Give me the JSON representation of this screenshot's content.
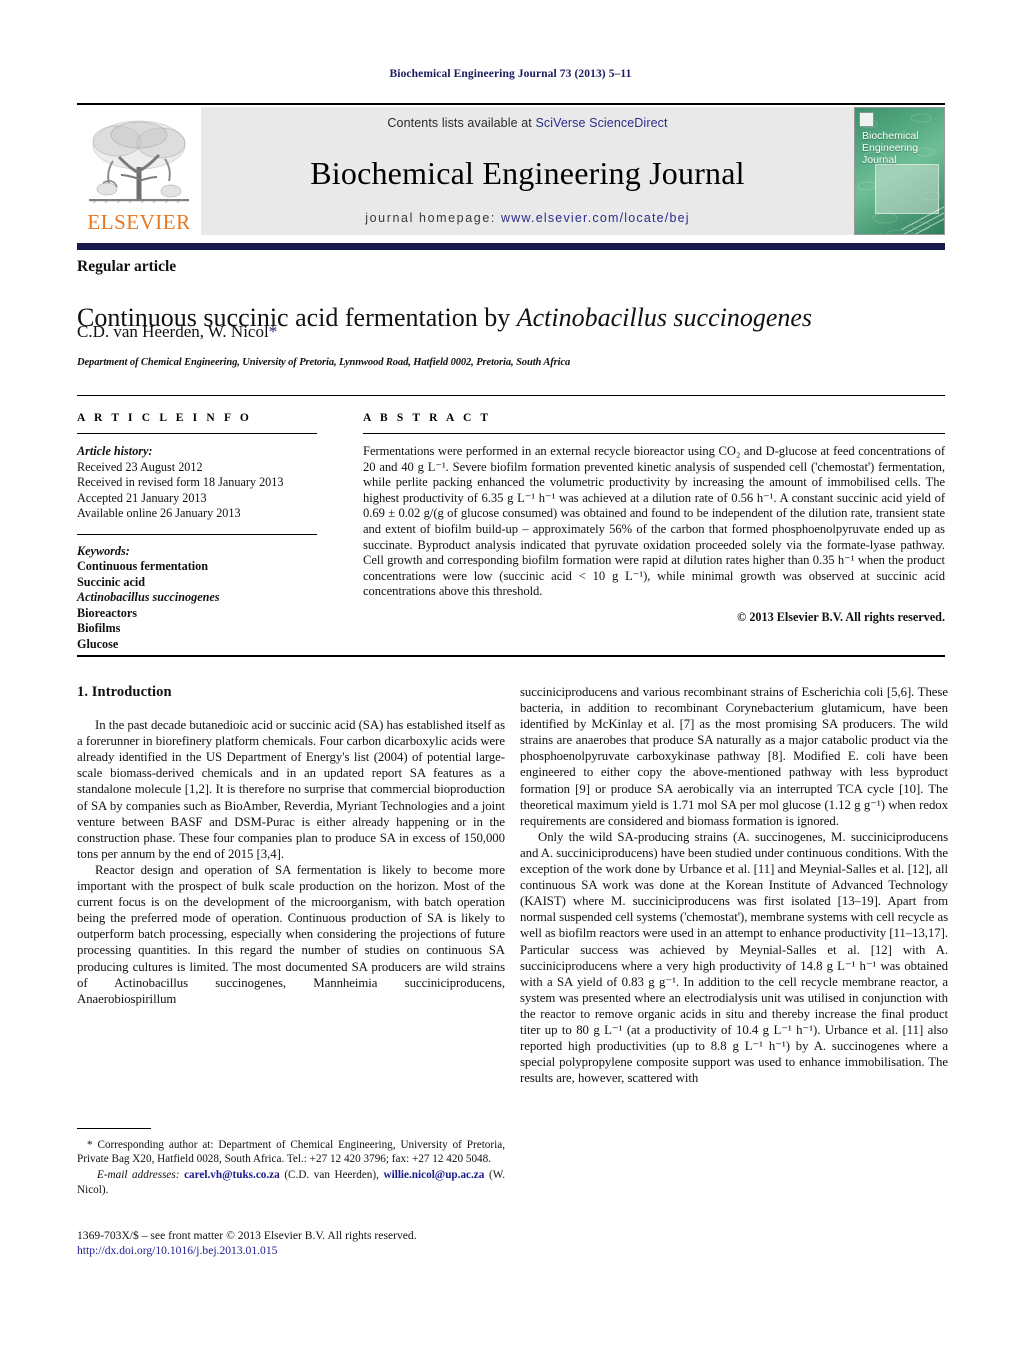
{
  "running_head": "Biochemical Engineering Journal 73 (2013) 5–11",
  "masthead": {
    "elsevier_wordmark": "ELSEVIER",
    "contents_prefix": "Contents lists available at ",
    "contents_link": "SciVerse ScienceDirect",
    "journal_title": "Biochemical Engineering Journal",
    "homepage_prefix": "journal homepage: ",
    "homepage_url": "www.elsevier.com/locate/bej",
    "cover_title": "Biochemical Engineering Journal",
    "brand_color": "#E87722",
    "link_color": "#2c2c8c",
    "band_color": "#19194d"
  },
  "title_block": {
    "article_type": "Regular article",
    "title_plain": "Continuous succinic acid fermentation by ",
    "title_italic": "Actinobacillus succinogenes",
    "authors": "C.D. van Heerden, W. Nicol",
    "author_star": "*",
    "affiliation": "Department of Chemical Engineering, University of Pretoria, Lynnwood Road, Hatfield 0002, Pretoria, South Africa"
  },
  "article_info": {
    "heading": "A R T I C L E   I N F O",
    "history_label": "Article history:",
    "history": [
      "Received 23 August 2012",
      "Received in revised form 18 January 2013",
      "Accepted 21 January 2013",
      "Available online 26 January 2013"
    ],
    "keywords_label": "Keywords:",
    "keywords": [
      "Continuous fermentation",
      "Succinic acid",
      "Actinobacillus succinogenes",
      "Bioreactors",
      "Biofilms",
      "Glucose"
    ],
    "keyword_italic_index": 2
  },
  "abstract": {
    "heading": "A B S T R A C T",
    "body": "Fermentations were performed in an external recycle bioreactor using CO₂ and D-glucose at feed concentrations of 20 and 40 g L⁻¹. Severe biofilm formation prevented kinetic analysis of suspended cell ('chemostat') fermentation, while perlite packing enhanced the volumetric productivity by increasing the amount of immobilised cells. The highest productivity of 6.35 g L⁻¹ h⁻¹ was achieved at a dilution rate of 0.56 h⁻¹. A constant succinic acid yield of 0.69 ± 0.02 g/(g of glucose consumed) was obtained and found to be independent of the dilution rate, transient state and extent of biofilm build-up – approximately 56% of the carbon that formed phosphoenolpyruvate ended up as succinate. Byproduct analysis indicated that pyruvate oxidation proceeded solely via the formate-lyase pathway. Cell growth and corresponding biofilm formation were rapid at dilution rates higher than 0.35 h⁻¹ when the product concentrations were low (succinic acid < 10 g L⁻¹), while minimal growth was observed at succinic acid concentrations above this threshold.",
    "copyright": "© 2013 Elsevier B.V. All rights reserved."
  },
  "introduction": {
    "heading": "1. Introduction",
    "left_paragraphs": [
      "In the past decade butanedioic acid or succinic acid (SA) has established itself as a forerunner in biorefinery platform chemicals. Four carbon dicarboxylic acids were already identified in the US Department of Energy's list (2004) of potential large-scale biomass-derived chemicals and in an updated report SA features as a standalone molecule [1,2]. It is therefore no surprise that commercial bioproduction of SA by companies such as BioAmber, Reverdia, Myriant Technologies and a joint venture between BASF and DSM-Purac is either already happening or in the construction phase. These four companies plan to produce SA in excess of 150,000 tons per annum by the end of 2015 [3,4].",
      "Reactor design and operation of SA fermentation is likely to become more important with the prospect of bulk scale production on the horizon. Most of the current focus is on the development of the microorganism, with batch operation being the preferred mode of operation. Continuous production of SA is likely to outperform batch processing, especially when considering the projections of future processing quantities. In this regard the number of studies on continuous SA producing cultures is limited. The most documented SA producers are wild strains of Actinobacillus succinogenes, Mannheimia succiniciproducens, Anaerobiospirillum"
    ],
    "right_paragraphs": [
      "succiniciproducens and various recombinant strains of Escherichia coli [5,6]. These bacteria, in addition to recombinant Corynebacterium glutamicum, have been identified by McKinlay et al. [7] as the most promising SA producers. The wild strains are anaerobes that produce SA naturally as a major catabolic product via the phosphoenolpyruvate carboxykinase pathway [8]. Modified E. coli have been engineered to either copy the above-mentioned pathway with less byproduct formation [9] or produce SA aerobically via an interrupted TCA cycle [10]. The theoretical maximum yield is 1.71 mol SA per mol glucose (1.12 g g⁻¹) when redox requirements are considered and biomass formation is ignored.",
      "Only the wild SA-producing strains (A. succinogenes, M. succiniciproducens and A. succiniciproducens) have been studied under continuous conditions. With the exception of the work done by Urbance et al. [11] and Meynial-Salles et al. [12], all continuous SA work was done at the Korean Institute of Advanced Technology (KAIST) where M. succiniciproducens was first isolated [13–19]. Apart from normal suspended cell systems ('chemostat'), membrane systems with cell recycle as well as biofilm reactors were used in an attempt to enhance productivity [11–13,17]. Particular success was achieved by Meynial-Salles et al. [12] with A. succiniciproducens where a very high productivity of 14.8 g L⁻¹ h⁻¹ was obtained with a SA yield of 0.83 g g⁻¹. In addition to the cell recycle membrane reactor, a system was presented where an electrodialysis unit was utilised in conjunction with the reactor to remove organic acids in situ and thereby increase the final product titer up to 80 g L⁻¹ (at a productivity of 10.4 g L⁻¹ h⁻¹). Urbance et al. [11] also reported high productivities (up to 8.8 g L⁻¹ h⁻¹) by A. succinogenes where a special polypropylene composite support was used to enhance immobilisation. The results are, however, scattered with"
    ]
  },
  "footnote": {
    "corresponding": "* Corresponding author at: Department of Chemical Engineering, University of Pretoria, Private Bag X20, Hatfield 0028, South Africa. Tel.: +27 12 420 3796; fax: +27 12 420 5048.",
    "email_label": "E-mail addresses:",
    "email_1": "carel.vh@tuks.co.za",
    "email_1_owner": "(C.D. van Heerden),",
    "email_2": "willie.nicol@up.ac.za",
    "email_2_owner": "(W. Nicol)."
  },
  "footer": {
    "issn_line": "1369-703X/$ – see front matter © 2013 Elsevier B.V. All rights reserved.",
    "doi": "http://dx.doi.org/10.1016/j.bej.2013.01.015"
  }
}
